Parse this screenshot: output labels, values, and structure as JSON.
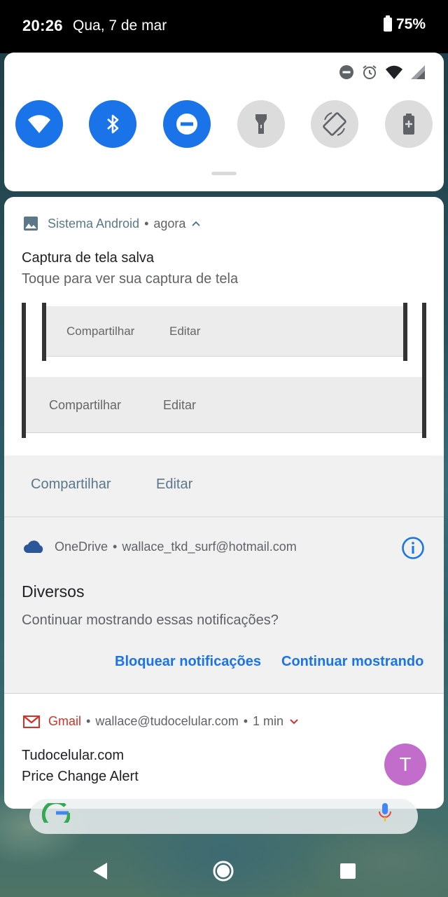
{
  "status_bar": {
    "time": "20:26",
    "date": "Qua, 7 de mar",
    "battery_percent": "75%",
    "icons": [
      "battery-icon"
    ]
  },
  "quick_settings": {
    "status_icons": [
      "do-not-disturb-icon",
      "alarm-icon",
      "wifi-signal-icon",
      "cell-signal-icon"
    ],
    "tiles": [
      {
        "name": "wifi-icon",
        "state": "on"
      },
      {
        "name": "bluetooth-icon",
        "state": "on"
      },
      {
        "name": "do-not-disturb-icon",
        "state": "on"
      },
      {
        "name": "flashlight-icon",
        "state": "off"
      },
      {
        "name": "auto-rotate-icon",
        "state": "off"
      },
      {
        "name": "battery-saver-icon",
        "state": "off"
      }
    ],
    "accent_color": "#1a73e8"
  },
  "notifications": {
    "screenshot": {
      "app_name": "Sistema Android",
      "separator": "•",
      "time": "agora",
      "title": "Captura de tela salva",
      "text": "Toque para ver sua captura de tela",
      "preview": {
        "inner_share": "Compartilhar",
        "inner_edit": "Editar",
        "outer_share": "Compartilhar",
        "outer_edit": "Editar"
      },
      "actions": {
        "share": "Compartilhar",
        "edit": "Editar"
      }
    },
    "onedrive": {
      "app_name": "OneDrive",
      "separator": "•",
      "account": "wallace_tkd_surf@hotmail.com",
      "title": "Diversos",
      "text": "Continuar mostrando essas notificações?",
      "actions": {
        "block": "Bloquear notificações",
        "keep": "Continuar mostrando"
      }
    },
    "gmail": {
      "app_name": "Gmail",
      "separator": "•",
      "account": "wallace@tudocelular.com",
      "time": "1 min",
      "title": "Tudocelular.com",
      "text": "Price Change Alert",
      "avatar_letter": "T",
      "avatar_color": "#c26ccc",
      "app_color": "#d93025"
    }
  },
  "nav_bar": {
    "buttons": [
      "back-icon",
      "home-icon",
      "recents-icon"
    ]
  }
}
